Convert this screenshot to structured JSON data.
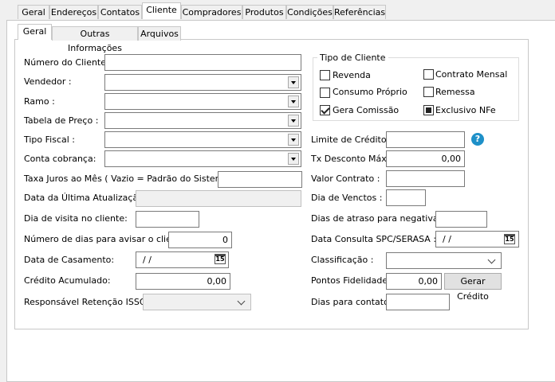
{
  "top_tabs": [
    "Geral",
    "Endereços",
    "Contatos",
    "Cliente",
    "Compradores",
    "Produtos",
    "Condições",
    "Referências"
  ],
  "sub_tabs": [
    "Geral",
    "Outras Informações",
    "Arquivos"
  ],
  "left": {
    "numero_cliente": "Número do Cliente :",
    "vendedor": "Vendedor :",
    "ramo": "Ramo :",
    "tabela_preco": "Tabela de Preço :",
    "tipo_fiscal": "Tipo Fiscal :",
    "conta_cobranca": "Conta cobrança:",
    "taxa_juros": "Taxa Juros ao Mês  ( Vazio = Padrão do Sistema) :",
    "data_ultima": "Data da Última Atualização:",
    "dia_visita": "Dia de visita no cliente:",
    "num_dias_avisar": "Número de dias para avisar o cliente:",
    "num_dias_avisar_value": "0",
    "data_casamento": "Data de Casamento:",
    "data_casamento_value": "/ /",
    "credito_acumulado": "Crédito Acumulado:",
    "credito_acumulado_value": "0,00",
    "responsavel_issqn": "Responsável Retenção ISSQN"
  },
  "tipo_cliente": {
    "title": "Tipo de Cliente",
    "revenda": "Revenda",
    "contrato_mensal": "Contrato Mensal",
    "consumo_proprio": "Consumo Próprio",
    "remessa": "Remessa",
    "gera_comissao": "Gera Comissão",
    "exclusivo_nfe": "Exclusivo NFe"
  },
  "right": {
    "limite_credito": "Limite de Crédito :",
    "tx_desconto": "Tx Desconto Máx :",
    "tx_desconto_value": "0,00",
    "valor_contrato": "Valor Contrato :",
    "dia_venctos": "Dia de Venctos :",
    "dias_atraso": "Dias de atraso para negativar :",
    "data_spc": "Data Consulta SPC/SERASA :",
    "data_spc_value": "/ /",
    "classificacao": "Classificação :",
    "pontos_fidelidade": "Pontos Fidelidade :",
    "pontos_fidelidade_value": "0,00",
    "gerar_credito": "Gerar Crédito",
    "dias_contato": "Dias para contato:"
  },
  "icons": {
    "calendar_glyph": "15",
    "help_glyph": "?"
  }
}
